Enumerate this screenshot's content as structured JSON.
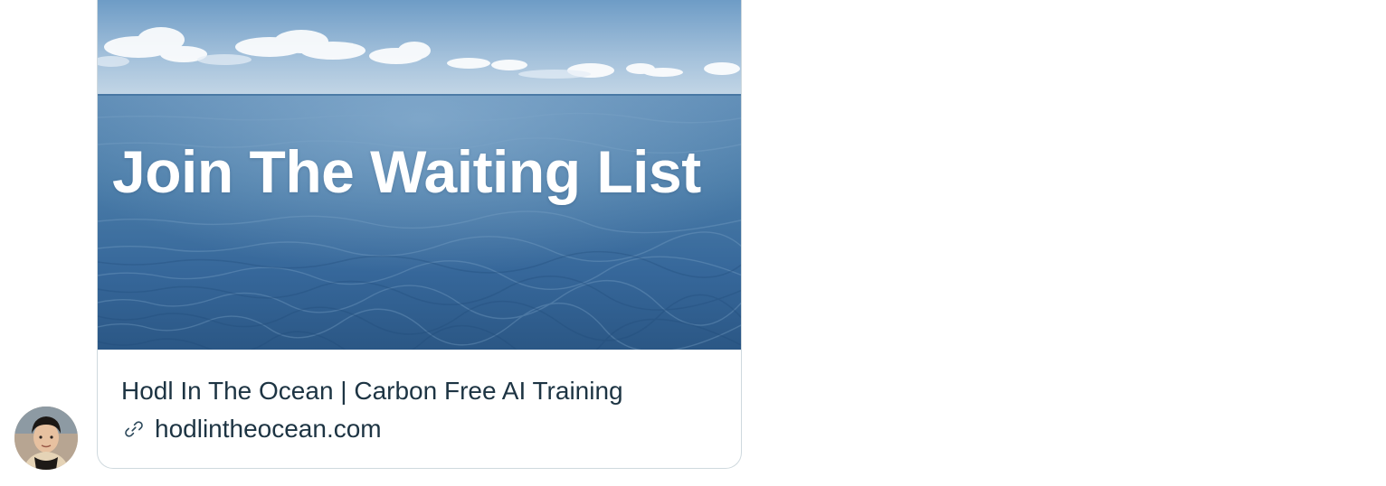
{
  "card": {
    "image_overlay_text": "Join The Waiting List",
    "title": "Hodl In The Ocean | Carbon Free AI Training",
    "domain": "hodlintheocean.com"
  },
  "icons": {
    "link": "link-icon",
    "avatar": "avatar"
  },
  "colors": {
    "text": "#1d3443",
    "border": "#cfd9de",
    "ocean_deep": "#2c5f8a",
    "sky": "#8fb4d6"
  }
}
